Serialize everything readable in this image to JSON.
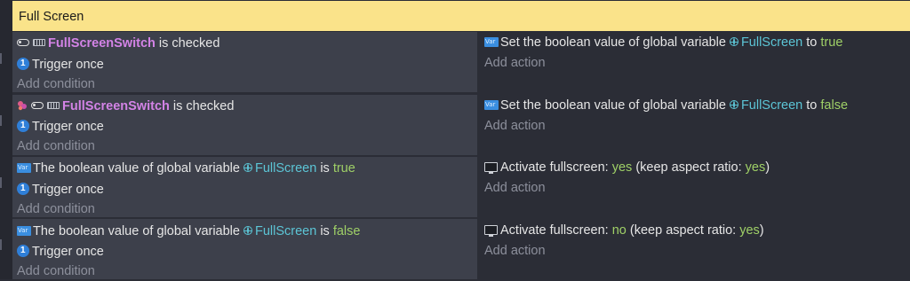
{
  "group": {
    "title": "Full Screen"
  },
  "events": [
    {
      "conditions": {
        "line1": {
          "object": "FullScreenSwitch",
          "text": " is checked"
        },
        "line2": "Trigger once",
        "add": "Add condition"
      },
      "actions": {
        "line1": {
          "prefix": "Set the boolean value of global variable",
          "variable": "FullScreen",
          "mid": " to ",
          "value": "true"
        },
        "add": "Add action"
      }
    },
    {
      "conditions": {
        "line1": {
          "object": "FullScreenSwitch",
          "text": " is checked"
        },
        "line2": "Trigger once",
        "add": "Add condition"
      },
      "actions": {
        "line1": {
          "prefix": "Set the boolean value of global variable",
          "variable": "FullScreen",
          "mid": " to ",
          "value": "false"
        },
        "add": "Add action"
      }
    },
    {
      "conditions": {
        "line1": {
          "prefix": "The boolean value of global variable",
          "variable": "FullScreen",
          "mid": " is ",
          "value": "true"
        },
        "line2": "Trigger once",
        "add": "Add condition"
      },
      "actions": {
        "line1": {
          "prefix": "Activate fullscreen: ",
          "value1": "yes",
          "mid": " (keep aspect ratio: ",
          "value2": "yes",
          "suffix": ")"
        },
        "add": "Add action"
      }
    },
    {
      "conditions": {
        "line1": {
          "prefix": "The boolean value of global variable",
          "variable": "FullScreen",
          "mid": " is ",
          "value": "false"
        },
        "line2": "Trigger once",
        "add": "Add condition"
      },
      "actions": {
        "line1": {
          "prefix": "Activate fullscreen: ",
          "value1": "no",
          "mid": " (keep aspect ratio: ",
          "value2": "yes",
          "suffix": ")"
        },
        "add": "Add action"
      }
    }
  ],
  "colors": {
    "header_bg": "#fae38a",
    "object_name": "#d383e6",
    "variable": "#5cc5d6",
    "value": "#9fd067",
    "condition_bg": "#3d404b",
    "action_bg": "#2b2d36"
  },
  "icons": [
    "toggle-icon",
    "switch-object-icon",
    "invert-condition-icon",
    "trigger-once-icon",
    "variable-icon",
    "global-variable-icon",
    "screen-icon"
  ]
}
